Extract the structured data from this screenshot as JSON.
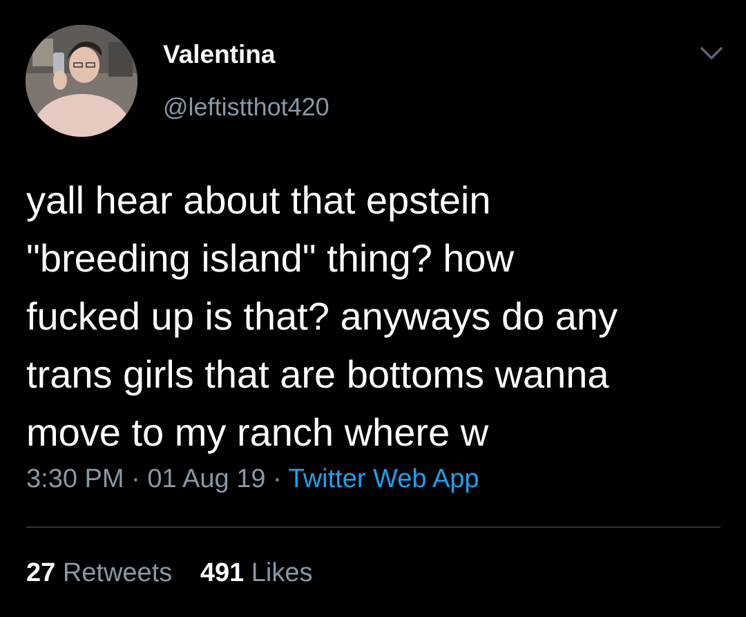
{
  "profile": {
    "display_name": "Valentina",
    "handle": "@leftistthot420"
  },
  "tweet": {
    "lines": [
      "yall hear about that epstein",
      "\"breeding island\" thing? how",
      "fucked up is that? anyways do any",
      "trans girls that are bottoms wanna",
      "move to my ranch where w"
    ],
    "time": "3:30 PM",
    "date": "01 Aug 19",
    "separator": "·",
    "source": "Twitter Web App"
  },
  "stats": {
    "retweets_count": "27",
    "retweets_label": "Retweets",
    "likes_count": "491",
    "likes_label": "Likes"
  },
  "colors": {
    "background": "#000000",
    "primary_text": "#ffffff",
    "secondary_text": "#8899a6",
    "accent": "#1da1f2"
  },
  "icons": {
    "menu": "chevron-down-icon"
  }
}
